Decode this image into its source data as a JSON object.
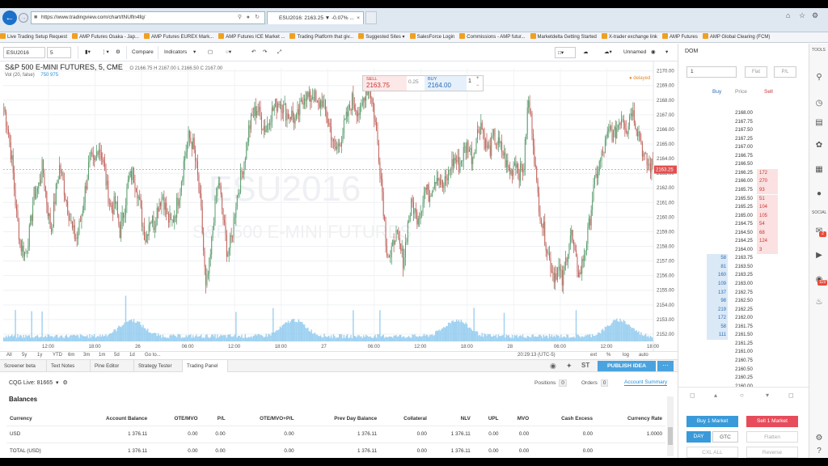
{
  "browser": {
    "url": "https://www.tradingview.com/chart/tNUfln4fq/",
    "tab_title": "ESU2016: 2163.25 ▼ -0.07% ...",
    "favorites": [
      "Live Trading Setup Request",
      "AMP Futures Osaka - Jap...",
      "AMP Futures EUREX Mark...",
      "AMP Futures ICE Market ...",
      "Trading Platform that giv...",
      "Suggested Sites ▾",
      "SalesForce Login",
      "Commissions - AMP futur...",
      "Marketdelta Getting Started",
      "X-trader exchange link",
      "AMP Futures",
      "AMP Global Clearing (FCM)"
    ]
  },
  "toolbar": {
    "symbol": "ESU2016",
    "interval": "5",
    "compare_label": "Compare",
    "indicators_label": "Indicators",
    "layout_label": "Unnamed"
  },
  "chart": {
    "title": "S&P 500 E-MINI FUTURES, 5, CME",
    "ohlc": "O 2166.75  H 2167.00  L 2166.50  C 2167.00",
    "volume_label": "Vol (20, false)",
    "volume_value": "750  975",
    "watermark_symbol": "ESU2016",
    "watermark_name": "S&P 500 E-MINI FUTURES",
    "delayed_label": "delayed",
    "sell_label": "SELL",
    "sell_price": "2163.75",
    "spread": "0.25",
    "buy_label": "BUY",
    "buy_price": "2164.00",
    "quantity": "1",
    "current_price": "2163.25",
    "time_readout": "20:29:13 (UTC-5)"
  },
  "chart_data": {
    "type": "candlestick",
    "y_ticks": [
      "2170.00",
      "2169.00",
      "2168.00",
      "2167.00",
      "2166.00",
      "2165.00",
      "2164.00",
      "2163.00",
      "2162.00",
      "2161.00",
      "2160.00",
      "2159.00",
      "2158.00",
      "2157.00",
      "2156.00",
      "2155.00",
      "2154.00",
      "2153.00",
      "2152.00"
    ],
    "ylim": [
      2151.5,
      2170.2
    ],
    "x_ticks": [
      "12:00",
      "18:00",
      "26",
      "06:00",
      "12:00",
      "18:00",
      "27",
      "06:00",
      "12:00",
      "18:00",
      "28",
      "06:00",
      "12:00",
      "18:00"
    ],
    "price_path": [
      2167.5,
      2166.0,
      2163.5,
      2160.0,
      2158.0,
      2157.5,
      2159.0,
      2161.5,
      2162.0,
      2163.5,
      2161.0,
      2159.0,
      2161.5,
      2163.5,
      2162.0,
      2160.5,
      2159.0,
      2158.5,
      2160.0,
      2162.0,
      2164.0,
      2163.5,
      2165.0,
      2164.0,
      2162.0,
      2160.5,
      2161.0,
      2159.0,
      2160.5,
      2162.5,
      2163.0,
      2162.0,
      2160.0,
      2158.5,
      2160.0,
      2159.5,
      2161.0,
      2161.5,
      2160.0,
      2159.5,
      2160.5,
      2162.0,
      2164.0,
      2165.5,
      2165.0,
      2163.0,
      2160.0,
      2155.0,
      2157.0,
      2160.5,
      2162.5,
      2160.0,
      2157.5,
      2158.5,
      2161.0,
      2162.5,
      2164.0,
      2166.0,
      2167.0,
      2167.5,
      2166.5,
      2166.0,
      2167.0,
      2167.5,
      2168.0,
      2167.5,
      2167.0,
      2167.0,
      2166.5,
      2167.5,
      2168.5,
      2168.0,
      2168.5,
      2167.5,
      2168.0,
      2167.0,
      2166.0,
      2164.5,
      2165.0,
      2166.0,
      2167.0,
      2168.0,
      2167.5,
      2167.0,
      2168.5,
      2169.0,
      2167.5,
      2165.0,
      2162.0,
      2158.0,
      2157.0,
      2159.0,
      2158.0,
      2157.0,
      2159.5,
      2161.0,
      2160.0,
      2160.5,
      2162.0,
      2161.5,
      2162.5,
      2163.0,
      2162.0,
      2162.5,
      2163.5,
      2164.0,
      2163.5,
      2164.5,
      2165.0,
      2164.0,
      2165.5,
      2166.5,
      2165.0,
      2164.5,
      2165.5,
      2165.0,
      2164.5,
      2163.5,
      2163.0,
      2164.0,
      2163.0,
      2163.5,
      2168.0,
      2166.0,
      2162.0,
      2160.0,
      2158.5,
      2157.0,
      2156.0,
      2156.5,
      2155.5,
      2157.5,
      2159.0,
      2157.0,
      2156.0,
      2157.5,
      2159.0,
      2161.5,
      2163.0,
      2164.0,
      2165.0,
      2166.0,
      2165.5,
      2166.5,
      2167.0,
      2166.0,
      2167.5,
      2166.5,
      2165.5,
      2164.0,
      2163.5,
      2163.5
    ]
  },
  "timeframes": [
    "All",
    "5y",
    "1y",
    "YTD",
    "6m",
    "3m",
    "1m",
    "5d",
    "1d",
    "Go to..."
  ],
  "timeline_right": [
    "ext",
    "%",
    "log",
    "auto"
  ],
  "bottom_tabs": [
    "Screener beta",
    "Text Notes",
    "Pine Editor",
    "Strategy Tester",
    "Trading Panel"
  ],
  "publish_label": "PUBLISH IDEA",
  "account": {
    "broker": "CQG Live: 81665",
    "positions_label": "Positions",
    "positions_count": "0",
    "orders_label": "Orders",
    "orders_count": "0",
    "summary_label": "Account Summary",
    "balances_title": "Balances",
    "columns": [
      "Currency",
      "Account Balance",
      "OTE/MVO",
      "P/L",
      "OTE/MVO+P/L",
      "Prev Day Balance",
      "Collateral",
      "NLV",
      "UPL",
      "MVO",
      "Cash Excess",
      "Currency Rate"
    ],
    "rows": [
      [
        "USD",
        "1 376.11",
        "0.00",
        "0.00",
        "0.00",
        "1 376.11",
        "0.00",
        "1 376.11",
        "0.00",
        "0.00",
        "0.00",
        "1.0000"
      ],
      [
        "TOTAL (USD)",
        "1 376.11",
        "0.00",
        "0.00",
        "0.00",
        "1 376.11",
        "0.00",
        "1 376.11",
        "0.00",
        "0.00",
        "0.00",
        ""
      ]
    ]
  },
  "dom": {
    "title": "DOM",
    "qty": "1",
    "flat_label": "Flat",
    "pl_label": "P/L",
    "head_buy": "Buy",
    "head_price": "Price",
    "head_sell": "Sell",
    "rows": [
      {
        "price": "2168.00",
        "bid": "",
        "ask": ""
      },
      {
        "price": "2167.75",
        "bid": "",
        "ask": ""
      },
      {
        "price": "2167.50",
        "bid": "",
        "ask": ""
      },
      {
        "price": "2167.25",
        "bid": "",
        "ask": ""
      },
      {
        "price": "2167.00",
        "bid": "",
        "ask": ""
      },
      {
        "price": "2166.75",
        "bid": "",
        "ask": ""
      },
      {
        "price": "2166.50",
        "bid": "",
        "ask": ""
      },
      {
        "price": "2166.25",
        "bid": "",
        "ask": "172"
      },
      {
        "price": "2166.00",
        "bid": "",
        "ask": "270"
      },
      {
        "price": "2165.75",
        "bid": "",
        "ask": "93"
      },
      {
        "price": "2165.50",
        "bid": "",
        "ask": "51"
      },
      {
        "price": "2165.25",
        "bid": "",
        "ask": "104"
      },
      {
        "price": "2165.00",
        "bid": "",
        "ask": "105"
      },
      {
        "price": "2164.75",
        "bid": "",
        "ask": "54"
      },
      {
        "price": "2164.50",
        "bid": "",
        "ask": "68"
      },
      {
        "price": "2164.25",
        "bid": "",
        "ask": "124"
      },
      {
        "price": "2164.00",
        "bid": "",
        "ask": "3"
      },
      {
        "price": "2163.75",
        "bid": "58",
        "ask": ""
      },
      {
        "price": "2163.50",
        "bid": "81",
        "ask": ""
      },
      {
        "price": "2163.25",
        "bid": "160",
        "ask": ""
      },
      {
        "price": "2163.00",
        "bid": "109",
        "ask": ""
      },
      {
        "price": "2162.75",
        "bid": "137",
        "ask": ""
      },
      {
        "price": "2162.50",
        "bid": "98",
        "ask": ""
      },
      {
        "price": "2162.25",
        "bid": "219",
        "ask": ""
      },
      {
        "price": "2162.00",
        "bid": "172",
        "ask": ""
      },
      {
        "price": "2161.75",
        "bid": "58",
        "ask": ""
      },
      {
        "price": "2161.50",
        "bid": "111",
        "ask": ""
      },
      {
        "price": "2161.25",
        "bid": "",
        "ask": ""
      },
      {
        "price": "2161.00",
        "bid": "",
        "ask": ""
      },
      {
        "price": "2160.75",
        "bid": "",
        "ask": ""
      },
      {
        "price": "2160.50",
        "bid": "",
        "ask": ""
      },
      {
        "price": "2160.25",
        "bid": "",
        "ask": ""
      },
      {
        "price": "2160.00",
        "bid": "",
        "ask": ""
      }
    ],
    "buy_market": "Buy 1 Market",
    "sell_market": "Sell 1 Market",
    "day": "DAY",
    "gtc": "GTC",
    "flatten": "Flatten",
    "cxl_all": "CXL ALL",
    "reverse": "Reverse"
  },
  "tools": {
    "tools_label": "TOOLS",
    "social_label": "SOCIAL",
    "notif_1": "2",
    "notif_2": "119"
  },
  "colors": {
    "up_candle": "#5a9e6f",
    "down_candle": "#c0625c",
    "volume": "#8ec9ef",
    "accent": "#4aa3df",
    "sell": "#e74c5c"
  }
}
